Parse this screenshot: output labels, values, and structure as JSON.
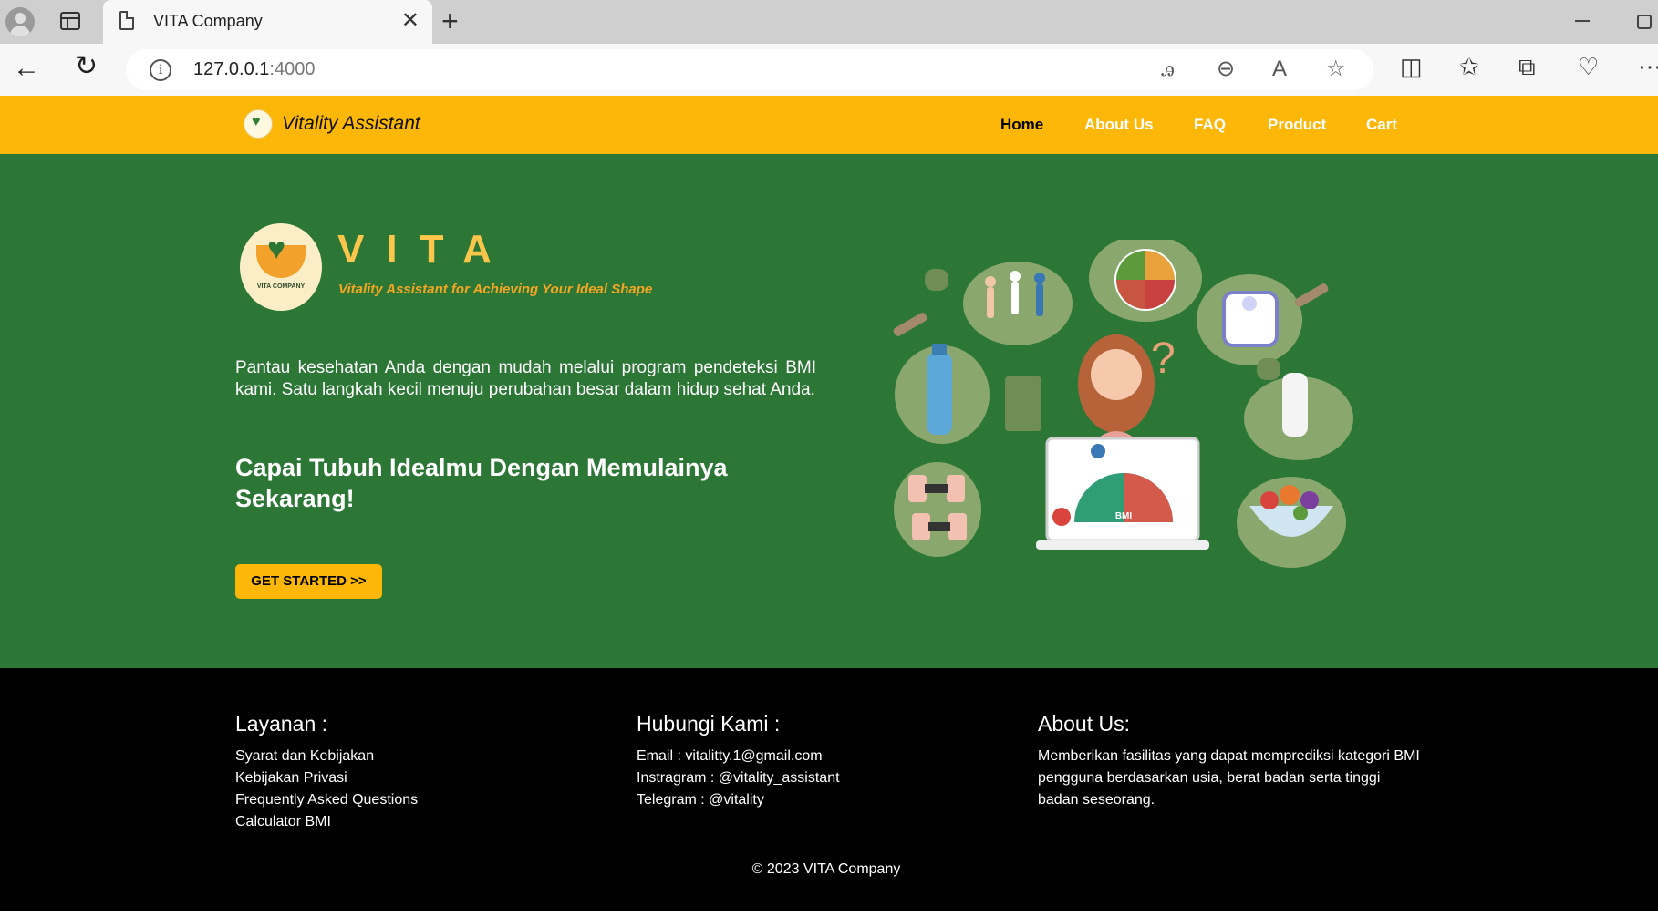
{
  "browser": {
    "tab_title": "VITA Company",
    "url_host": "127.0.0.1",
    "url_port": ":4000",
    "icons": [
      "profile-icon",
      "tab-actions-icon",
      "page-icon",
      "close-icon",
      "plus-icon",
      "back-icon",
      "reload-icon",
      "info-icon",
      "translate-icon",
      "zoom-out-icon",
      "read-aloud-icon",
      "favorite-star-icon",
      "split-screen-icon",
      "favorites-icon",
      "collections-icon",
      "browser-essentials-icon",
      "more-icon"
    ]
  },
  "navbar": {
    "brand": "Vitality Assistant",
    "links": [
      "Home",
      "About Us",
      "FAQ",
      "Product",
      "Cart"
    ],
    "active": "Home",
    "bg_color": "#fcb709"
  },
  "hero": {
    "logo_word": "VITA",
    "logo_caption": "VITA COMPANY",
    "tagline": "Vitality Assistant for Achieving Your Ideal Shape",
    "description": "Pantau kesehatan Anda dengan mudah melalui program pendeteksi BMI kami. Satu langkah kecil menuju perubahan besar dalam hidup sehat Anda.",
    "heading": "Capai Tubuh Idealmu Dengan Memulainya Sekarang!",
    "cta": "GET STARTED >>",
    "bg_color": "#2c7636",
    "illustration_label": "BMI"
  },
  "footer": {
    "services": {
      "title": "Layanan :",
      "items": [
        "Syarat dan Kebijakan",
        "Kebijakan Privasi",
        "Frequently Asked Questions",
        "Calculator BMI"
      ]
    },
    "contact": {
      "title": "Hubungi Kami :",
      "items": [
        "Email : vitalitty.1@gmail.com",
        "Instragram : @vitality_assistant",
        "Telegram : @vitality"
      ]
    },
    "about": {
      "title": "About Us:",
      "text": "Memberikan fasilitas yang dapat memprediksi kategori BMI pengguna berdasarkan usia, berat badan serta tinggi badan seseorang."
    },
    "copyright": "© 2023 VITA Company"
  }
}
